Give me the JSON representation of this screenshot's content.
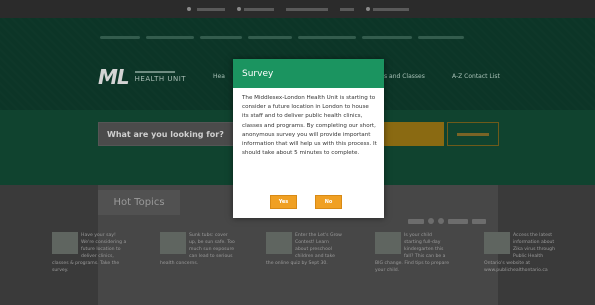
{
  "topbar": {
    "items": [
      "",
      "",
      "",
      "",
      ""
    ]
  },
  "main_nav": {
    "home_partial": "Hea",
    "programs_partial": "s and Classes",
    "az": "A-Z Contact List"
  },
  "logo": {
    "mark": "ML",
    "name": "HEALTH UNIT"
  },
  "search": {
    "placeholder": "What are you looking for?",
    "advanced_label": ""
  },
  "hot_topics": {
    "title": "Hot Topics",
    "topics": [
      {
        "text": "Have your say! We're considering a future location to deliver clinics, classes & programs. Take the survey."
      },
      {
        "text": "Sunk tubs: cover up, be sun safe. Too much sun exposure can lead to serious health concerns."
      },
      {
        "text": "Enter the Let's Grow Contest! Learn about preschool children and take the online quiz by Sept 30."
      },
      {
        "text": "Is your child starting full-day kindergarten this fall? This can be a BIG change. Find tips to prepare your child."
      },
      {
        "text": "Access the latest information about Zika virus through Public Health Ontario's website at www.publichealthontario.ca"
      }
    ]
  },
  "modal": {
    "title": "Survey",
    "body": "The Middlesex-London Health Unit is starting to consider a future location in London to house its staff and to deliver public health clinics, classes and programs. By completing our short, anonymous survey you will provide important information that will help us with this process. It should take about 5 minutes to complete.",
    "yes_label": "Yes",
    "no_label": "No"
  },
  "colors": {
    "modal_header": "#1b9460",
    "button": "#f0a023"
  }
}
